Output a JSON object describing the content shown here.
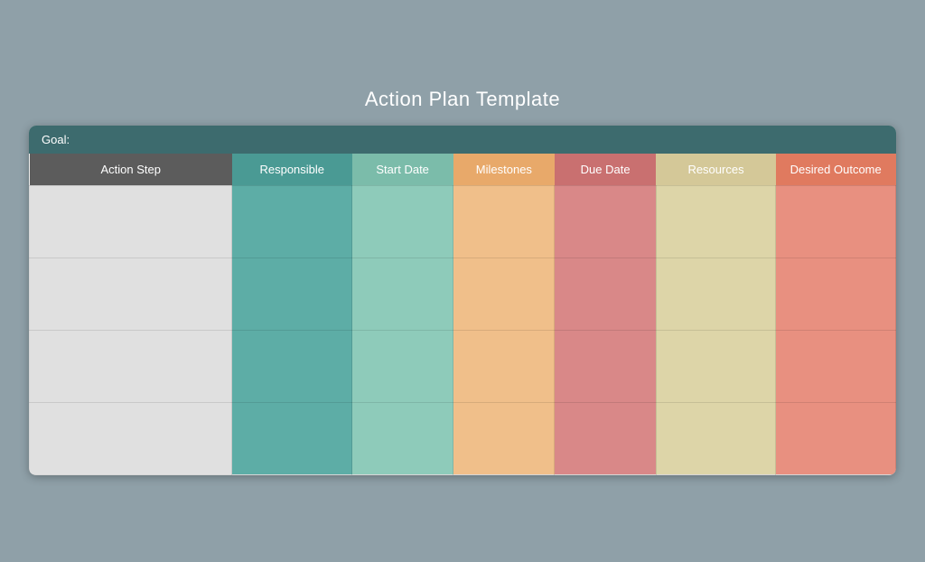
{
  "page": {
    "title": "Action Plan Template",
    "goal_label": "Goal:",
    "columns": [
      {
        "id": "action",
        "label": "Action Step",
        "class": "col-action"
      },
      {
        "id": "resp",
        "label": "Responsible",
        "class": "col-resp"
      },
      {
        "id": "start",
        "label": "Start Date",
        "class": "col-start"
      },
      {
        "id": "mile",
        "label": "Milestones",
        "class": "col-mile"
      },
      {
        "id": "due",
        "label": "Due Date",
        "class": "col-due"
      },
      {
        "id": "res",
        "label": "Resources",
        "class": "col-res"
      },
      {
        "id": "desired",
        "label": "Desired Outcome",
        "class": "col-desired"
      }
    ],
    "rows": 4
  }
}
